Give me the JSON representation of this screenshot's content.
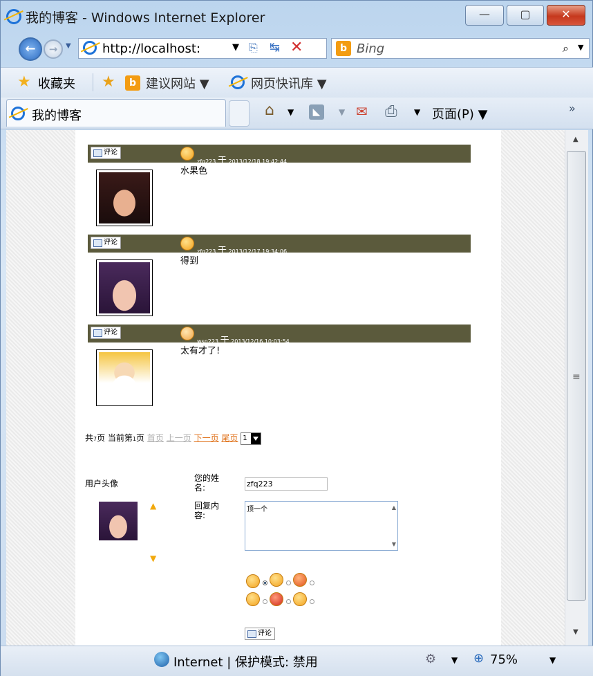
{
  "window": {
    "title": "我的博客 - Windows Internet Explorer",
    "min": "—",
    "max": "▢",
    "close": "✕"
  },
  "nav": {
    "back_icon": "back-arrow-icon",
    "address": "http://localhost:",
    "search_provider": "Bing",
    "search_icon": "search-icon"
  },
  "favorites": {
    "label": "收藏夹",
    "suggested": "建议网站 ▼",
    "webslice": "网页快讯库 ▼"
  },
  "tabs": {
    "active_label": "我的博客",
    "page_menu": "页面(P) ▼",
    "chevron": "»"
  },
  "comments": [
    {
      "button": "评论",
      "author": "zfq223",
      "yu": "于",
      "time": "2013/12/18 19:42:44",
      "text": "水果色",
      "avatar": "portrait-dark-hair"
    },
    {
      "button": "评论",
      "author": "zfq223",
      "yu": "于",
      "time": "2013/12/17 19:34:06",
      "text": "得到",
      "avatar": "portrait-purple-hair"
    },
    {
      "button": "评论",
      "author": "wsn223",
      "yu": "于",
      "time": "2013/12/16 10:03:54",
      "text": "太有才了!",
      "avatar": "cartoon-hp"
    }
  ],
  "pager": {
    "prefix": "共",
    "total": "7",
    "mid": "页 当前第",
    "current": "1",
    "suffix": "页",
    "first": "首页",
    "prev": "上一页",
    "next": "下一页",
    "last": "尾页",
    "select_value": "1"
  },
  "form": {
    "avatar_label": "用户头像",
    "name_label": "您的姓名:",
    "name_value": "zfq223",
    "content_label": "回复内容:",
    "content_value": "顶一个",
    "submit": "评论"
  },
  "status": {
    "zone": "Internet | 保护模式: 禁用",
    "zoom": "75%"
  },
  "colors": {
    "comment_bar": "#5b5a3c",
    "link_active": "#e0731c",
    "link_inactive": "#b0b0b0"
  }
}
